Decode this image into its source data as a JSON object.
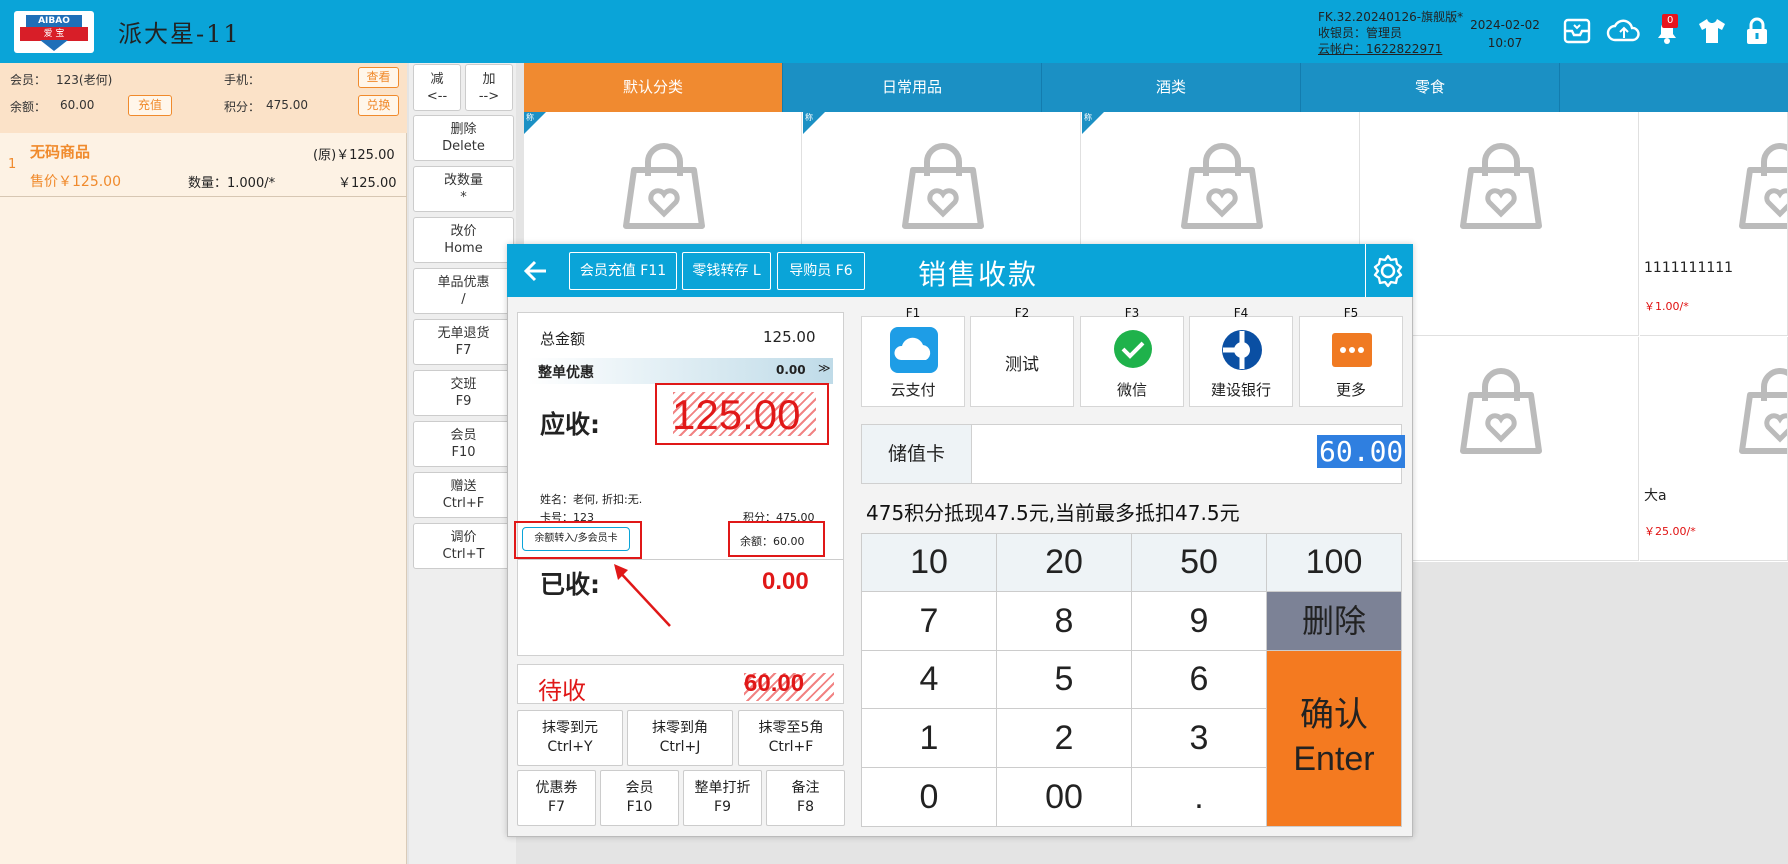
{
  "app": {
    "logo_top": "AIBAO",
    "logo_mid": "爱 宝",
    "title": "派大星-11",
    "version": "FK.32.20240126-旗舰版*",
    "cashier": "收银员：管理员",
    "cloud_account": "云帐户：1622822971",
    "date": "2024-02-02",
    "time": "10:07",
    "notification_count": "0"
  },
  "member": {
    "label_member": "会员：",
    "member_value": "123(老何)",
    "label_phone": "手机：",
    "phone_value": "",
    "view_btn": "查看",
    "label_balance": "余额：",
    "balance_value": "60.00",
    "recharge_btn": "充值",
    "label_points": "积分：",
    "points_value": "475.00",
    "exchange_btn": "兑换"
  },
  "cart": {
    "items": [
      {
        "index": "1",
        "name": "无码商品",
        "orig": "(原)￥125.00",
        "sale": "售价￥125.00",
        "qty": "数量：1.000/*",
        "total": "￥125.00"
      }
    ]
  },
  "functions": {
    "minus": "减",
    "minus_key": "<--",
    "plus": "加",
    "plus_key": "-->",
    "items": [
      {
        "label": "删除",
        "key": "Delete"
      },
      {
        "label": "改数量",
        "key": "*"
      },
      {
        "label": "改价",
        "key": "Home"
      },
      {
        "label": "单品优惠",
        "key": "/"
      },
      {
        "label": "无单退货",
        "key": "F7"
      },
      {
        "label": "交班",
        "key": "F9"
      },
      {
        "label": "会员",
        "key": "F10"
      },
      {
        "label": "赠送",
        "key": "Ctrl+F"
      },
      {
        "label": "调价",
        "key": "Ctrl+T"
      }
    ]
  },
  "categories": [
    "默认分类",
    "日常用品",
    "酒类",
    "零食"
  ],
  "products": {
    "corner_tag": "称",
    "p1_name": "1111111111",
    "p1_price": "￥1.00/*",
    "p2_name": "大a",
    "p2_price": "￥25.00/*"
  },
  "dialog": {
    "title": "销售收款",
    "btn_recharge": "会员充值 F11",
    "btn_change": "零钱转存 L",
    "btn_guide": "导购员 F6",
    "total_label": "总金额",
    "total_value": "125.00",
    "discount_label": "整单优惠",
    "discount_value": "0.00",
    "receivable_label": "应收:",
    "receivable_value": "125.00",
    "member_info": "姓名：老何, 折扣:无.",
    "card_no": "卡号：123",
    "points": "积分：475.00",
    "transfer_btn": "余额转入/多会员卡",
    "balance": "余额：60.00",
    "received_label": "已收:",
    "received_value": "0.00",
    "pending_label": "待收",
    "pending_value": "60.00",
    "round_buttons": [
      {
        "label": "抹零到元",
        "key": "Ctrl+Y"
      },
      {
        "label": "抹零到角",
        "key": "Ctrl+J"
      },
      {
        "label": "抹零至5角",
        "key": "Ctrl+F"
      }
    ],
    "bottom_buttons": [
      {
        "label": "优惠券",
        "key": "F7"
      },
      {
        "label": "会员",
        "key": "F10"
      },
      {
        "label": "整单打折",
        "key": "F9"
      },
      {
        "label": "备注",
        "key": "F8"
      }
    ],
    "payments": [
      {
        "key": "F1",
        "label": "云支付"
      },
      {
        "key": "F2",
        "label": "测试"
      },
      {
        "key": "F3",
        "label": "微信"
      },
      {
        "key": "F4",
        "label": "建设银行"
      },
      {
        "key": "F5",
        "label": "更多"
      }
    ],
    "card_label": "储值卡",
    "card_amount": "60.00",
    "points_hint": "475积分抵现47.5元,当前最多抵扣47.5元",
    "keys": [
      "10",
      "20",
      "50",
      "100",
      "7",
      "8",
      "9",
      "删除",
      "4",
      "5",
      "6",
      "1",
      "2",
      "3",
      "0",
      "00",
      "."
    ],
    "confirm": "确认",
    "confirm_key": "Enter"
  },
  "colors": {
    "header": "#0aa4d8",
    "accent": "#f08a30",
    "confirm": "#f47a20",
    "delete_key": "#7c8296",
    "alert_red": "#e01818"
  }
}
